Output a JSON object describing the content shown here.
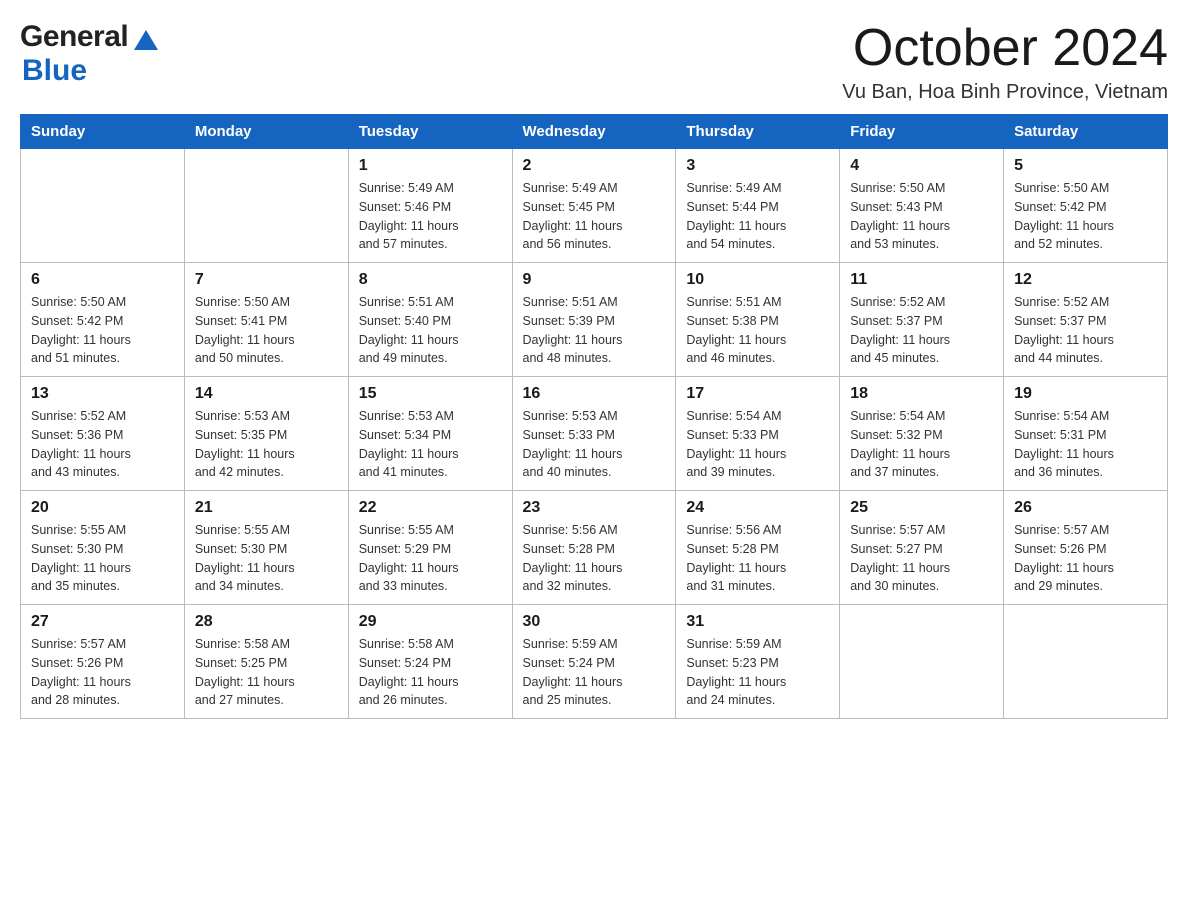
{
  "header": {
    "logo_general": "General",
    "logo_blue": "Blue",
    "month_title": "October 2024",
    "location": "Vu Ban, Hoa Binh Province, Vietnam"
  },
  "days_of_week": [
    "Sunday",
    "Monday",
    "Tuesday",
    "Wednesday",
    "Thursday",
    "Friday",
    "Saturday"
  ],
  "weeks": [
    [
      {
        "day": "",
        "info": ""
      },
      {
        "day": "",
        "info": ""
      },
      {
        "day": "1",
        "info": "Sunrise: 5:49 AM\nSunset: 5:46 PM\nDaylight: 11 hours\nand 57 minutes."
      },
      {
        "day": "2",
        "info": "Sunrise: 5:49 AM\nSunset: 5:45 PM\nDaylight: 11 hours\nand 56 minutes."
      },
      {
        "day": "3",
        "info": "Sunrise: 5:49 AM\nSunset: 5:44 PM\nDaylight: 11 hours\nand 54 minutes."
      },
      {
        "day": "4",
        "info": "Sunrise: 5:50 AM\nSunset: 5:43 PM\nDaylight: 11 hours\nand 53 minutes."
      },
      {
        "day": "5",
        "info": "Sunrise: 5:50 AM\nSunset: 5:42 PM\nDaylight: 11 hours\nand 52 minutes."
      }
    ],
    [
      {
        "day": "6",
        "info": "Sunrise: 5:50 AM\nSunset: 5:42 PM\nDaylight: 11 hours\nand 51 minutes."
      },
      {
        "day": "7",
        "info": "Sunrise: 5:50 AM\nSunset: 5:41 PM\nDaylight: 11 hours\nand 50 minutes."
      },
      {
        "day": "8",
        "info": "Sunrise: 5:51 AM\nSunset: 5:40 PM\nDaylight: 11 hours\nand 49 minutes."
      },
      {
        "day": "9",
        "info": "Sunrise: 5:51 AM\nSunset: 5:39 PM\nDaylight: 11 hours\nand 48 minutes."
      },
      {
        "day": "10",
        "info": "Sunrise: 5:51 AM\nSunset: 5:38 PM\nDaylight: 11 hours\nand 46 minutes."
      },
      {
        "day": "11",
        "info": "Sunrise: 5:52 AM\nSunset: 5:37 PM\nDaylight: 11 hours\nand 45 minutes."
      },
      {
        "day": "12",
        "info": "Sunrise: 5:52 AM\nSunset: 5:37 PM\nDaylight: 11 hours\nand 44 minutes."
      }
    ],
    [
      {
        "day": "13",
        "info": "Sunrise: 5:52 AM\nSunset: 5:36 PM\nDaylight: 11 hours\nand 43 minutes."
      },
      {
        "day": "14",
        "info": "Sunrise: 5:53 AM\nSunset: 5:35 PM\nDaylight: 11 hours\nand 42 minutes."
      },
      {
        "day": "15",
        "info": "Sunrise: 5:53 AM\nSunset: 5:34 PM\nDaylight: 11 hours\nand 41 minutes."
      },
      {
        "day": "16",
        "info": "Sunrise: 5:53 AM\nSunset: 5:33 PM\nDaylight: 11 hours\nand 40 minutes."
      },
      {
        "day": "17",
        "info": "Sunrise: 5:54 AM\nSunset: 5:33 PM\nDaylight: 11 hours\nand 39 minutes."
      },
      {
        "day": "18",
        "info": "Sunrise: 5:54 AM\nSunset: 5:32 PM\nDaylight: 11 hours\nand 37 minutes."
      },
      {
        "day": "19",
        "info": "Sunrise: 5:54 AM\nSunset: 5:31 PM\nDaylight: 11 hours\nand 36 minutes."
      }
    ],
    [
      {
        "day": "20",
        "info": "Sunrise: 5:55 AM\nSunset: 5:30 PM\nDaylight: 11 hours\nand 35 minutes."
      },
      {
        "day": "21",
        "info": "Sunrise: 5:55 AM\nSunset: 5:30 PM\nDaylight: 11 hours\nand 34 minutes."
      },
      {
        "day": "22",
        "info": "Sunrise: 5:55 AM\nSunset: 5:29 PM\nDaylight: 11 hours\nand 33 minutes."
      },
      {
        "day": "23",
        "info": "Sunrise: 5:56 AM\nSunset: 5:28 PM\nDaylight: 11 hours\nand 32 minutes."
      },
      {
        "day": "24",
        "info": "Sunrise: 5:56 AM\nSunset: 5:28 PM\nDaylight: 11 hours\nand 31 minutes."
      },
      {
        "day": "25",
        "info": "Sunrise: 5:57 AM\nSunset: 5:27 PM\nDaylight: 11 hours\nand 30 minutes."
      },
      {
        "day": "26",
        "info": "Sunrise: 5:57 AM\nSunset: 5:26 PM\nDaylight: 11 hours\nand 29 minutes."
      }
    ],
    [
      {
        "day": "27",
        "info": "Sunrise: 5:57 AM\nSunset: 5:26 PM\nDaylight: 11 hours\nand 28 minutes."
      },
      {
        "day": "28",
        "info": "Sunrise: 5:58 AM\nSunset: 5:25 PM\nDaylight: 11 hours\nand 27 minutes."
      },
      {
        "day": "29",
        "info": "Sunrise: 5:58 AM\nSunset: 5:24 PM\nDaylight: 11 hours\nand 26 minutes."
      },
      {
        "day": "30",
        "info": "Sunrise: 5:59 AM\nSunset: 5:24 PM\nDaylight: 11 hours\nand 25 minutes."
      },
      {
        "day": "31",
        "info": "Sunrise: 5:59 AM\nSunset: 5:23 PM\nDaylight: 11 hours\nand 24 minutes."
      },
      {
        "day": "",
        "info": ""
      },
      {
        "day": "",
        "info": ""
      }
    ]
  ],
  "colors": {
    "header_bg": "#1565c0",
    "header_text": "#ffffff",
    "border": "#bbbbbb",
    "day_number": "#1a1a1a",
    "day_info": "#333333"
  }
}
